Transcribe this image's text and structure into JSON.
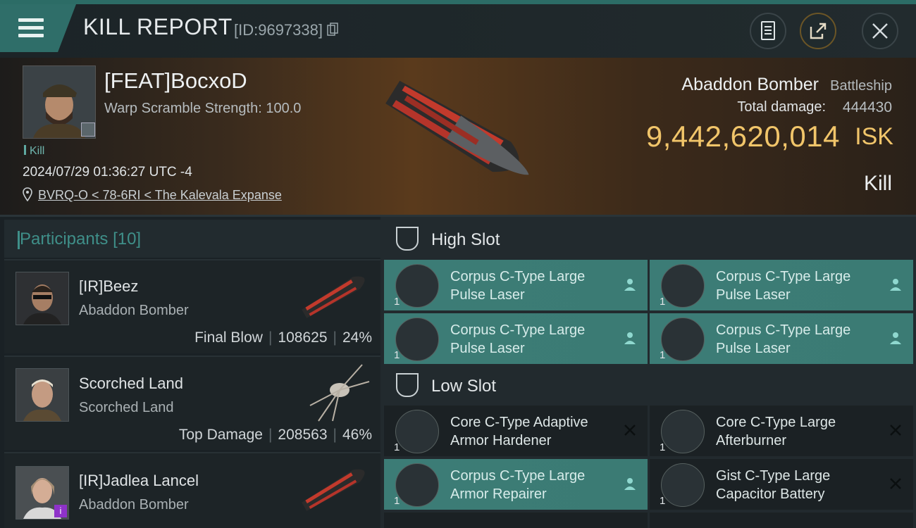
{
  "header": {
    "title": "KILL REPORT",
    "report_id": "[ID:9697338]",
    "menu_icon": "hamburger-icon",
    "buttons": [
      "clipboard-icon",
      "share-icon",
      "close-icon"
    ]
  },
  "victim": {
    "name": "[FEAT]BocxoD",
    "warp_scramble": "Warp Scramble Strength: 100.0",
    "tag": "Kill",
    "datetime": "2024/07/29 01:36:27 UTC -4",
    "location": "BVRQ-O < 78-6RI < The Kalevala Expanse",
    "ship_name": "Abaddon Bomber",
    "ship_class": "Battleship",
    "total_damage_label": "Total damage:",
    "total_damage": "444430",
    "isk_value": "9,442,620,014",
    "isk_unit": "ISK",
    "result": "Kill"
  },
  "participants": {
    "title": "Participants",
    "count": "[10]",
    "rows": [
      {
        "name": "[IR]Beez",
        "ship": "Abaddon Bomber",
        "role": "Final Blow",
        "damage": "108625",
        "percent": "24%"
      },
      {
        "name": "Scorched Land",
        "ship": "Scorched Land",
        "role": "Top Damage",
        "damage": "208563",
        "percent": "46%"
      },
      {
        "name": "[IR]Jadlea Lancel",
        "ship": "Abaddon Bomber",
        "role": "",
        "damage": "",
        "percent": ""
      }
    ]
  },
  "slots": {
    "high": {
      "title": "High Slot",
      "modules": [
        {
          "line1": "Corpus C-Type Large",
          "line2": "Pulse Laser",
          "qty": "1",
          "state": "dropped"
        },
        {
          "line1": "Corpus C-Type Large",
          "line2": "Pulse Laser",
          "qty": "1",
          "state": "dropped"
        },
        {
          "line1": "Corpus C-Type Large",
          "line2": "Pulse Laser",
          "qty": "1",
          "state": "dropped"
        },
        {
          "line1": "Corpus C-Type Large",
          "line2": "Pulse Laser",
          "qty": "1",
          "state": "dropped"
        }
      ]
    },
    "low": {
      "title": "Low Slot",
      "modules": [
        {
          "line1": "Core C-Type Adaptive",
          "line2": "Armor Hardener",
          "qty": "1",
          "state": "destroyed"
        },
        {
          "line1": "Core C-Type Large",
          "line2": "Afterburner",
          "qty": "1",
          "state": "destroyed"
        },
        {
          "line1": "Corpus C-Type Large",
          "line2": "Armor Repairer",
          "qty": "1",
          "state": "dropped"
        },
        {
          "line1": "Gist C-Type Large",
          "line2": "Capacitor Battery",
          "qty": "1",
          "state": "destroyed"
        }
      ]
    }
  },
  "colors": {
    "accent": "#3f8f89",
    "isk": "#f1c56a",
    "active_module": "#3b7b74"
  }
}
